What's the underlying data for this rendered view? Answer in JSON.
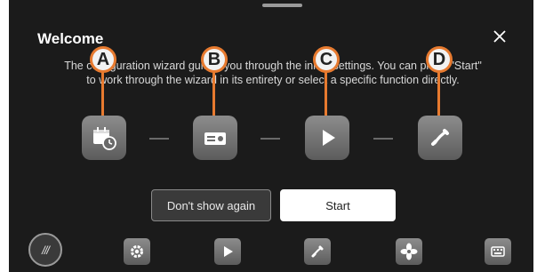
{
  "dialog": {
    "title": "Welcome",
    "description": "The configuration wizard guides you through the initial settings. You can press \"Start\" to work through the wizard in its entirety or select a specific function directly."
  },
  "steps": [
    {
      "callout": "A",
      "icon": "calendar-clock-icon"
    },
    {
      "callout": "B",
      "icon": "radio-icon"
    },
    {
      "callout": "C",
      "icon": "play-icon"
    },
    {
      "callout": "D",
      "icon": "phone-icon"
    }
  ],
  "buttons": {
    "dont_show_again": "Don't show again",
    "start": "Start"
  },
  "dock": {
    "menu_label": "///",
    "items": [
      "gear-icon",
      "play-icon",
      "phone-icon",
      "fan-icon",
      "keyboard-icon"
    ]
  },
  "colors": {
    "background": "#1b1b1b",
    "callout_accent": "#e77a2f",
    "icon_tile": "#777777"
  }
}
